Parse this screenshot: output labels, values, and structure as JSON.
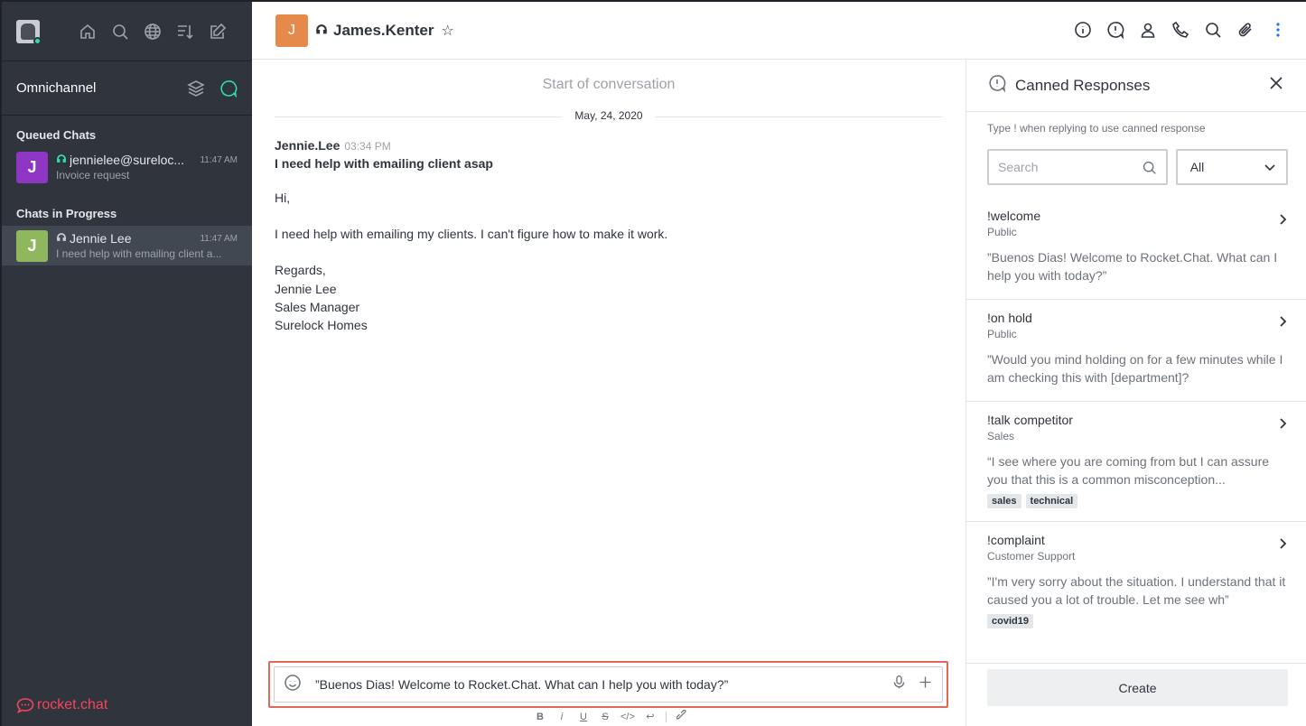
{
  "sidebar": {
    "section_title": "Omnichannel",
    "queued_label": "Queued Chats",
    "progress_label": "Chats in Progress",
    "queued": [
      {
        "initial": "J",
        "name": "jennielee@sureloc...",
        "time": "11:47 AM",
        "subtitle": "Invoice request",
        "avatar_color": "#8e35c4"
      }
    ],
    "in_progress": [
      {
        "initial": "J",
        "name": "Jennie Lee",
        "time": "11:47 AM",
        "subtitle": "I need help with emailing client a...",
        "avatar_color": "#8fb85e"
      }
    ],
    "brand": "rocket.chat"
  },
  "header": {
    "avatar_initial": "J",
    "title": "James.Kenter",
    "star": "☆"
  },
  "conversation": {
    "start_label": "Start of conversation",
    "date": "May, 24, 2020",
    "message": {
      "user": "Jennie.Lee",
      "time": "03:34 PM",
      "subject": "I need help with emailing client asap",
      "greeting": "Hi,",
      "line1": "I need help with emailing my clients. I can't figure how to make it work.",
      "regards": "Regards,",
      "sig_name": "Jennie Lee",
      "sig_title": "Sales Manager",
      "sig_company": "Surelock Homes"
    }
  },
  "composer": {
    "value": "”Buenos Dias! Welcome to Rocket.Chat. What can I help you with today?”",
    "format": [
      "B",
      "i",
      "U",
      "S",
      "</>",
      "↩",
      "🔗"
    ]
  },
  "panel": {
    "title": "Canned Responses",
    "hint": "Type ! when replying to use canned response",
    "search_placeholder": "Search",
    "filter_value": "All",
    "responses": [
      {
        "shortcut": "!welcome",
        "scope": "Public",
        "text": "”Buenos Dias! Welcome to Rocket.Chat. What can I help you with today?”",
        "tags": []
      },
      {
        "shortcut": "!on hold",
        "scope": "Public",
        "text": "”Would you mind holding on for a few minutes while I am checking this with [department]?",
        "tags": []
      },
      {
        "shortcut": "!talk competitor",
        "scope": "Sales",
        "text": "“I see where you are coming from but I can assure you that this is a common misconception...",
        "tags": [
          "sales",
          "technical"
        ]
      },
      {
        "shortcut": "!complaint",
        "scope": "Customer Support",
        "text": "”I'm very sorry about the situation. I understand that it caused you a lot of trouble. Let me see wh”",
        "tags": [
          "covid19"
        ]
      }
    ],
    "create_label": "Create"
  }
}
